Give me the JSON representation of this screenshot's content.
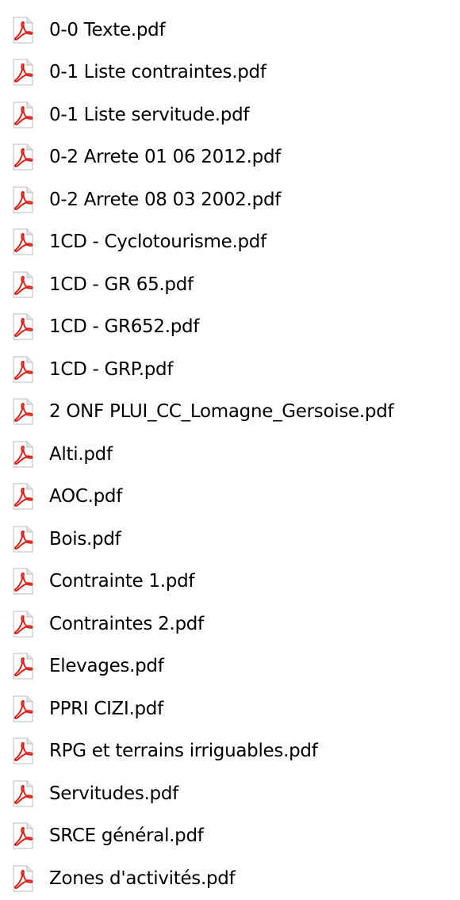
{
  "file_list": {
    "icon": "pdf-file-icon",
    "colors": {
      "page": "#ffffff",
      "page_border": "#b9b9b9",
      "fold": "#e6e6e6",
      "acrobat_red": "#d9231b"
    },
    "items": [
      {
        "name": "0-0 Texte.pdf"
      },
      {
        "name": "0-1 Liste contraintes.pdf"
      },
      {
        "name": "0-1 Liste servitude.pdf"
      },
      {
        "name": "0-2 Arrete 01 06 2012.pdf"
      },
      {
        "name": "0-2 Arrete 08 03 2002.pdf"
      },
      {
        "name": "1CD - Cyclotourisme.pdf"
      },
      {
        "name": "1CD - GR 65.pdf"
      },
      {
        "name": "1CD - GR652.pdf"
      },
      {
        "name": "1CD - GRP.pdf"
      },
      {
        "name": "2 ONF PLUI_CC_Lomagne_Gersoise.pdf"
      },
      {
        "name": "Alti.pdf"
      },
      {
        "name": "AOC.pdf"
      },
      {
        "name": "Bois.pdf"
      },
      {
        "name": "Contrainte 1.pdf"
      },
      {
        "name": "Contraintes 2.pdf"
      },
      {
        "name": "Elevages.pdf"
      },
      {
        "name": "PPRI CIZI.pdf"
      },
      {
        "name": "RPG et terrains irriguables.pdf"
      },
      {
        "name": "Servitudes.pdf"
      },
      {
        "name": "SRCE général.pdf"
      },
      {
        "name": "Zones d'activités.pdf"
      }
    ]
  }
}
